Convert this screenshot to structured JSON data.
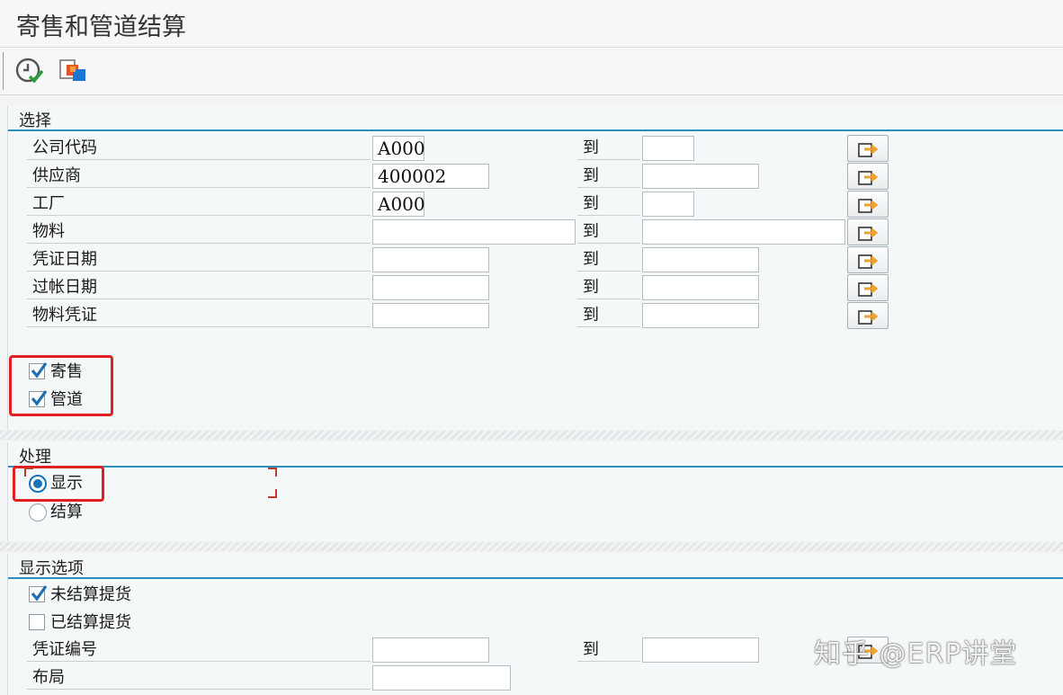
{
  "window": {
    "title": "寄售和管道结算"
  },
  "toolbar": {
    "buttons": [
      {
        "icon": "execute-clock-check-icon"
      },
      {
        "icon": "copy-variant-icon"
      }
    ]
  },
  "selection": {
    "title": "选择",
    "range_to_label": "到",
    "rows": [
      {
        "label": "公司代码",
        "from": "A000",
        "to": ""
      },
      {
        "label": "供应商",
        "from": "400002",
        "to": ""
      },
      {
        "label": "工厂",
        "from": "A000",
        "to": ""
      },
      {
        "label": "物料",
        "from": "",
        "to": ""
      },
      {
        "label": "凭证日期",
        "from": "",
        "to": ""
      },
      {
        "label": "过帐日期",
        "from": "",
        "to": ""
      },
      {
        "label": "物料凭证",
        "from": "",
        "to": ""
      }
    ],
    "checkboxes": [
      {
        "label": "寄售",
        "checked": true
      },
      {
        "label": "管道",
        "checked": true
      }
    ]
  },
  "processing": {
    "title": "处理",
    "options": [
      {
        "label": "显示",
        "selected": true
      },
      {
        "label": "结算",
        "selected": false
      }
    ]
  },
  "display_options": {
    "title": "显示选项",
    "checkboxes": [
      {
        "label": "未结算提货",
        "checked": true
      },
      {
        "label": "已结算提货",
        "checked": false
      }
    ],
    "doc_number": {
      "label": "凭证编号",
      "from": "",
      "to": ""
    },
    "layout": {
      "label": "布局",
      "value": ""
    }
  },
  "watermark": {
    "text": "知乎 @ERP讲堂"
  },
  "colors": {
    "accent_line": "#2c8fbd",
    "highlight": "#e02020",
    "radio_on": "#1673b8",
    "check": "#1a6fb5"
  }
}
